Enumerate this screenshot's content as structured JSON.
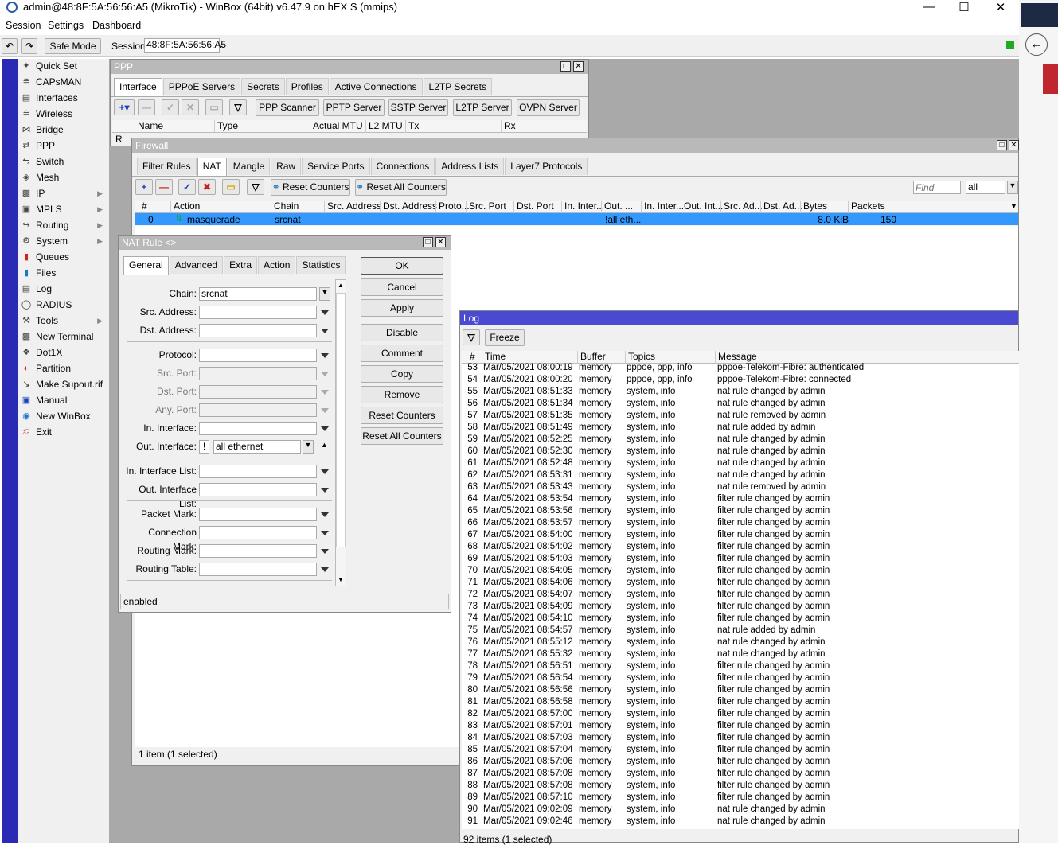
{
  "window": {
    "title": "admin@48:8F:5A:56:56:A5 (MikroTik) - WinBox (64bit) v6.47.9 on hEX S (mmips)"
  },
  "menu": [
    "Session",
    "Settings",
    "Dashboard"
  ],
  "toolbar": {
    "safe_mode": "Safe Mode",
    "session_label": "Session:",
    "session_value": "48:8F:5A:56:56:A5"
  },
  "sidebar": {
    "items": [
      {
        "label": "Quick Set",
        "icon": "wand-icon"
      },
      {
        "label": "CAPsMAN",
        "icon": "antenna-icon"
      },
      {
        "label": "Interfaces",
        "icon": "interfaces-icon"
      },
      {
        "label": "Wireless",
        "icon": "wireless-icon"
      },
      {
        "label": "Bridge",
        "icon": "bridge-icon"
      },
      {
        "label": "PPP",
        "icon": "ppp-icon"
      },
      {
        "label": "Switch",
        "icon": "switch-icon"
      },
      {
        "label": "Mesh",
        "icon": "mesh-icon"
      },
      {
        "label": "IP",
        "icon": "ip-icon",
        "sub": true
      },
      {
        "label": "MPLS",
        "icon": "mpls-icon",
        "sub": true
      },
      {
        "label": "Routing",
        "icon": "routing-icon",
        "sub": true
      },
      {
        "label": "System",
        "icon": "gear-icon",
        "sub": true
      },
      {
        "label": "Queues",
        "icon": "queues-icon"
      },
      {
        "label": "Files",
        "icon": "folder-icon"
      },
      {
        "label": "Log",
        "icon": "log-icon"
      },
      {
        "label": "RADIUS",
        "icon": "radius-icon"
      },
      {
        "label": "Tools",
        "icon": "tools-icon",
        "sub": true
      },
      {
        "label": "New Terminal",
        "icon": "terminal-icon"
      },
      {
        "label": "Dot1X",
        "icon": "dot1x-icon"
      },
      {
        "label": "Partition",
        "icon": "partition-icon"
      },
      {
        "label": "Make Supout.rif",
        "icon": "supout-icon"
      },
      {
        "label": "Manual",
        "icon": "manual-icon"
      },
      {
        "label": "New WinBox",
        "icon": "winbox-icon"
      },
      {
        "label": "Exit",
        "icon": "exit-icon"
      }
    ]
  },
  "ppp": {
    "title": "PPP",
    "tabs": [
      "Interface",
      "PPPoE Servers",
      "Secrets",
      "Profiles",
      "Active Connections",
      "L2TP Secrets"
    ],
    "buttons": [
      "PPP Scanner",
      "PPTP Server",
      "SSTP Server",
      "L2TP Server",
      "OVPN Server"
    ],
    "columns": [
      "Name",
      "Type",
      "Actual MTU",
      "L2 MTU",
      "Tx",
      "Rx"
    ],
    "row_flag": "R"
  },
  "firewall": {
    "title": "Firewall",
    "tabs": [
      "Filter Rules",
      "NAT",
      "Mangle",
      "Raw",
      "Service Ports",
      "Connections",
      "Address Lists",
      "Layer7 Protocols"
    ],
    "reset_counters": "Reset Counters",
    "reset_all": "Reset All Counters",
    "find_placeholder": "Find",
    "filter_value": "all",
    "columns": [
      "#",
      "Action",
      "Chain",
      "Src. Address",
      "Dst. Address",
      "Proto...",
      "Src. Port",
      "Dst. Port",
      "In. Inter...",
      "Out. ...",
      "In. Inter...",
      "Out. Int...",
      "Src. Ad...",
      "Dst. Ad...",
      "Bytes",
      "Packets"
    ],
    "row": {
      "num": "0",
      "action": "masquerade",
      "chain": "srcnat",
      "out": "!all eth...",
      "bytes": "8.0 KiB",
      "packets": "150"
    },
    "status": "1 item (1 selected)"
  },
  "nat_rule": {
    "title": "NAT Rule <>",
    "tabs": [
      "General",
      "Advanced",
      "Extra",
      "Action",
      "Statistics"
    ],
    "fields": {
      "chain": {
        "label": "Chain:",
        "value": "srcnat"
      },
      "src_address": {
        "label": "Src. Address:"
      },
      "dst_address": {
        "label": "Dst. Address:"
      },
      "protocol": {
        "label": "Protocol:"
      },
      "src_port": {
        "label": "Src. Port:"
      },
      "dst_port": {
        "label": "Dst. Port:"
      },
      "any_port": {
        "label": "Any. Port:"
      },
      "in_interface": {
        "label": "In. Interface:"
      },
      "out_interface": {
        "label": "Out. Interface:",
        "value": "all ethernet",
        "negate": "!"
      },
      "in_interface_list": {
        "label": "In. Interface List:"
      },
      "out_interface_list": {
        "label": "Out. Interface List:"
      },
      "packet_mark": {
        "label": "Packet Mark:"
      },
      "connection_mark": {
        "label": "Connection Mark:"
      },
      "routing_mark": {
        "label": "Routing Mark:"
      },
      "routing_table": {
        "label": "Routing Table:"
      }
    },
    "buttons": [
      "OK",
      "Cancel",
      "Apply",
      "Disable",
      "Comment",
      "Copy",
      "Remove",
      "Reset Counters",
      "Reset All Counters"
    ],
    "status": "enabled"
  },
  "log": {
    "title": "Log",
    "freeze": "Freeze",
    "columns": [
      "#",
      "Time",
      "Buffer",
      "Topics",
      "Message"
    ],
    "rows": [
      [
        "53",
        "Mar/05/2021 08:00:19",
        "memory",
        "pppoe, ppp, info",
        "pppoe-Telekom-Fibre: authenticated"
      ],
      [
        "54",
        "Mar/05/2021 08:00:20",
        "memory",
        "pppoe, ppp, info",
        "pppoe-Telekom-Fibre: connected"
      ],
      [
        "55",
        "Mar/05/2021 08:51:33",
        "memory",
        "system, info",
        "nat rule changed by admin"
      ],
      [
        "56",
        "Mar/05/2021 08:51:34",
        "memory",
        "system, info",
        "nat rule changed by admin"
      ],
      [
        "57",
        "Mar/05/2021 08:51:35",
        "memory",
        "system, info",
        "nat rule removed by admin"
      ],
      [
        "58",
        "Mar/05/2021 08:51:49",
        "memory",
        "system, info",
        "nat rule added by admin"
      ],
      [
        "59",
        "Mar/05/2021 08:52:25",
        "memory",
        "system, info",
        "nat rule changed by admin"
      ],
      [
        "60",
        "Mar/05/2021 08:52:30",
        "memory",
        "system, info",
        "nat rule changed by admin"
      ],
      [
        "61",
        "Mar/05/2021 08:52:48",
        "memory",
        "system, info",
        "nat rule changed by admin"
      ],
      [
        "62",
        "Mar/05/2021 08:53:31",
        "memory",
        "system, info",
        "nat rule changed by admin"
      ],
      [
        "63",
        "Mar/05/2021 08:53:43",
        "memory",
        "system, info",
        "nat rule removed by admin"
      ],
      [
        "64",
        "Mar/05/2021 08:53:54",
        "memory",
        "system, info",
        "filter rule changed by admin"
      ],
      [
        "65",
        "Mar/05/2021 08:53:56",
        "memory",
        "system, info",
        "filter rule changed by admin"
      ],
      [
        "66",
        "Mar/05/2021 08:53:57",
        "memory",
        "system, info",
        "filter rule changed by admin"
      ],
      [
        "67",
        "Mar/05/2021 08:54:00",
        "memory",
        "system, info",
        "filter rule changed by admin"
      ],
      [
        "68",
        "Mar/05/2021 08:54:02",
        "memory",
        "system, info",
        "filter rule changed by admin"
      ],
      [
        "69",
        "Mar/05/2021 08:54:03",
        "memory",
        "system, info",
        "filter rule changed by admin"
      ],
      [
        "70",
        "Mar/05/2021 08:54:05",
        "memory",
        "system, info",
        "filter rule changed by admin"
      ],
      [
        "71",
        "Mar/05/2021 08:54:06",
        "memory",
        "system, info",
        "filter rule changed by admin"
      ],
      [
        "72",
        "Mar/05/2021 08:54:07",
        "memory",
        "system, info",
        "filter rule changed by admin"
      ],
      [
        "73",
        "Mar/05/2021 08:54:09",
        "memory",
        "system, info",
        "filter rule changed by admin"
      ],
      [
        "74",
        "Mar/05/2021 08:54:10",
        "memory",
        "system, info",
        "filter rule changed by admin"
      ],
      [
        "75",
        "Mar/05/2021 08:54:57",
        "memory",
        "system, info",
        "nat rule added by admin"
      ],
      [
        "76",
        "Mar/05/2021 08:55:12",
        "memory",
        "system, info",
        "nat rule changed by admin"
      ],
      [
        "77",
        "Mar/05/2021 08:55:32",
        "memory",
        "system, info",
        "nat rule changed by admin"
      ],
      [
        "78",
        "Mar/05/2021 08:56:51",
        "memory",
        "system, info",
        "filter rule changed by admin"
      ],
      [
        "79",
        "Mar/05/2021 08:56:54",
        "memory",
        "system, info",
        "filter rule changed by admin"
      ],
      [
        "80",
        "Mar/05/2021 08:56:56",
        "memory",
        "system, info",
        "filter rule changed by admin"
      ],
      [
        "81",
        "Mar/05/2021 08:56:58",
        "memory",
        "system, info",
        "filter rule changed by admin"
      ],
      [
        "82",
        "Mar/05/2021 08:57:00",
        "memory",
        "system, info",
        "filter rule changed by admin"
      ],
      [
        "83",
        "Mar/05/2021 08:57:01",
        "memory",
        "system, info",
        "filter rule changed by admin"
      ],
      [
        "84",
        "Mar/05/2021 08:57:03",
        "memory",
        "system, info",
        "filter rule changed by admin"
      ],
      [
        "85",
        "Mar/05/2021 08:57:04",
        "memory",
        "system, info",
        "filter rule changed by admin"
      ],
      [
        "86",
        "Mar/05/2021 08:57:06",
        "memory",
        "system, info",
        "filter rule changed by admin"
      ],
      [
        "87",
        "Mar/05/2021 08:57:08",
        "memory",
        "system, info",
        "filter rule changed by admin"
      ],
      [
        "88",
        "Mar/05/2021 08:57:08",
        "memory",
        "system, info",
        "filter rule changed by admin"
      ],
      [
        "89",
        "Mar/05/2021 08:57:10",
        "memory",
        "system, info",
        "filter rule changed by admin"
      ],
      [
        "90",
        "Mar/05/2021 09:02:09",
        "memory",
        "system, info",
        "nat rule changed by admin"
      ],
      [
        "91",
        "Mar/05/2021 09:02:46",
        "memory",
        "system, info",
        "nat rule changed by admin"
      ]
    ],
    "status": "92 items (1 selected)"
  },
  "colors": {
    "accent_blue": "#2a2ab4",
    "active_title": "#4a4ad0",
    "selected_row": "#3399ff"
  }
}
